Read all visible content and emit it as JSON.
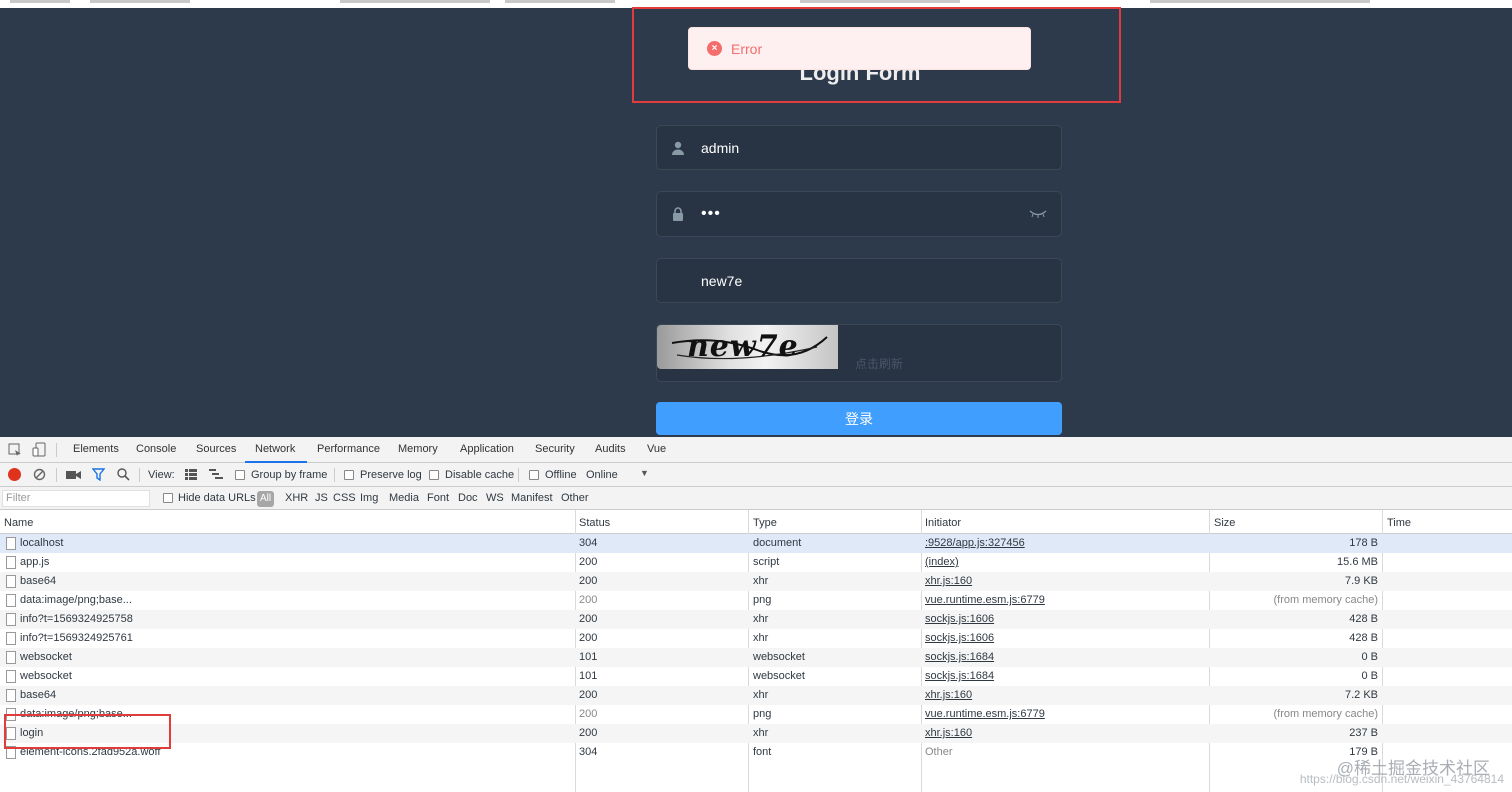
{
  "login": {
    "title": "Login Form",
    "toast_message": "Error",
    "username_value": "admin",
    "password_value": "•••",
    "captcha_value": "new7e",
    "captcha_image_text": "new7e",
    "captcha_hint": "点击刷新",
    "submit_label": "登录",
    "icons": [
      "user-icon",
      "lock-icon",
      "eye-closed-icon",
      "error-circle-icon"
    ],
    "colors": {
      "background": "#2d3a4b",
      "button": "#409eff",
      "error": "#f56c6c"
    }
  },
  "devtools": {
    "tabs": [
      "Elements",
      "Console",
      "Sources",
      "Network",
      "Performance",
      "Memory",
      "Application",
      "Security",
      "Audits",
      "Vue"
    ],
    "active_tab": "Network",
    "toolbar": {
      "view_label": "View:",
      "group_by_frame": "Group by frame",
      "preserve_log": "Preserve log",
      "disable_cache": "Disable cache",
      "offline": "Offline",
      "throttle": "Online"
    },
    "filter": {
      "placeholder": "Filter",
      "hide_data_urls": "Hide data URLs",
      "types": [
        "All",
        "XHR",
        "JS",
        "CSS",
        "Img",
        "Media",
        "Font",
        "Doc",
        "WS",
        "Manifest",
        "Other"
      ]
    },
    "columns": [
      "Name",
      "Status",
      "Type",
      "Initiator",
      "Size",
      "Time"
    ],
    "rows": [
      {
        "name": "localhost",
        "status": "304",
        "type": "document",
        "initiator": ":9528/app.js:327456",
        "size": "178 B"
      },
      {
        "name": "app.js",
        "status": "200",
        "type": "script",
        "initiator": "(index)",
        "size": "15.6 MB"
      },
      {
        "name": "base64",
        "status": "200",
        "type": "xhr",
        "initiator": "xhr.js:160",
        "size": "7.9 KB"
      },
      {
        "name": "data:image/png;base...",
        "status": "200",
        "type": "png",
        "initiator": "vue.runtime.esm.js:6779",
        "size": "(from memory cache)"
      },
      {
        "name": "info?t=1569324925758",
        "status": "200",
        "type": "xhr",
        "initiator": "sockjs.js:1606",
        "size": "428 B"
      },
      {
        "name": "info?t=1569324925761",
        "status": "200",
        "type": "xhr",
        "initiator": "sockjs.js:1606",
        "size": "428 B"
      },
      {
        "name": "websocket",
        "status": "101",
        "type": "websocket",
        "initiator": "sockjs.js:1684",
        "size": "0 B"
      },
      {
        "name": "websocket",
        "status": "101",
        "type": "websocket",
        "initiator": "sockjs.js:1684",
        "size": "0 B"
      },
      {
        "name": "base64",
        "status": "200",
        "type": "xhr",
        "initiator": "xhr.js:160",
        "size": "7.2 KB"
      },
      {
        "name": "data:image/png;base...",
        "status": "200",
        "type": "png",
        "initiator": "vue.runtime.esm.js:6779",
        "size": "(from memory cache)"
      },
      {
        "name": "login",
        "status": "200",
        "type": "xhr",
        "initiator": "xhr.js:160",
        "size": "237 B"
      },
      {
        "name": "element-icons.2fad952a.woff",
        "status": "304",
        "type": "font",
        "initiator": "Other",
        "size": "179 B"
      }
    ]
  },
  "watermark": {
    "main": "@稀土掘金技术社区",
    "sub": "https://blog.csdn.net/weixin_43764814"
  }
}
